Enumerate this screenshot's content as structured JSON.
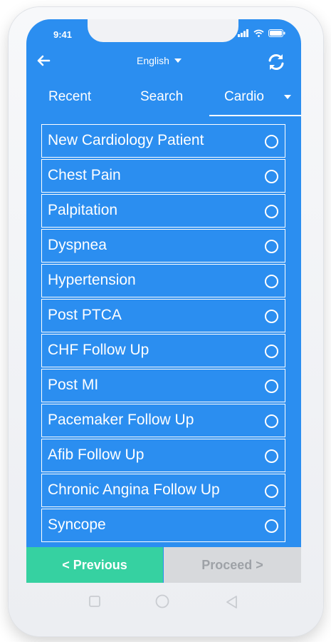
{
  "status": {
    "time": "9:41"
  },
  "header": {
    "language": "English"
  },
  "tabs": [
    {
      "label": "Recent"
    },
    {
      "label": "Search"
    },
    {
      "label": "Cardio"
    }
  ],
  "items": [
    {
      "label": "New Cardiology Patient"
    },
    {
      "label": "Chest Pain"
    },
    {
      "label": "Palpitation"
    },
    {
      "label": "Dyspnea"
    },
    {
      "label": "Hypertension"
    },
    {
      "label": "Post PTCA"
    },
    {
      "label": "CHF Follow Up"
    },
    {
      "label": "Post MI"
    },
    {
      "label": "Pacemaker Follow Up"
    },
    {
      "label": "Afib Follow Up"
    },
    {
      "label": "Chronic Angina Follow Up"
    },
    {
      "label": "Syncope"
    }
  ],
  "footer": {
    "previous_label": "< Previous",
    "proceed_label": "Proceed >"
  },
  "colors": {
    "primary": "#2b8ef0",
    "accent": "#36d1a1",
    "disabled": "#d7d9dc"
  }
}
